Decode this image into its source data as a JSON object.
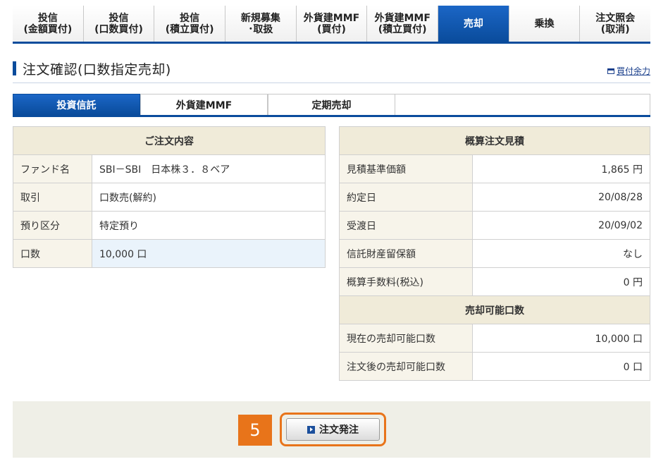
{
  "nav": {
    "tabs": [
      {
        "label": "投信\n(金額買付)"
      },
      {
        "label": "投信\n(口数買付)"
      },
      {
        "label": "投信\n(積立買付)"
      },
      {
        "label": "新規募集\n･取扱"
      },
      {
        "label": "外貨建MMF\n(買付)"
      },
      {
        "label": "外貨建MMF\n(積立買付)"
      },
      {
        "label": "売却"
      },
      {
        "label": "乗換"
      },
      {
        "label": "注文照会\n(取消)"
      }
    ]
  },
  "page": {
    "title": "注文確認(口数指定売却)",
    "buy_power_link": "買付余力"
  },
  "subtabs": [
    "投資信託",
    "外貨建MMF",
    "定期売却"
  ],
  "order_content": {
    "header": "ご注文内容",
    "rows": [
      {
        "label": "ファンド名",
        "value": "SBI－SBI　日本株３．８ベア"
      },
      {
        "label": "取引",
        "value": "口数売(解約)"
      },
      {
        "label": "預り区分",
        "value": "特定預り"
      },
      {
        "label": "口数",
        "value": "10,000 口"
      }
    ]
  },
  "estimate": {
    "header": "概算注文見積",
    "rows": [
      {
        "label": "見積基準価額",
        "value": "1,865 円"
      },
      {
        "label": "約定日",
        "value": "20/08/28"
      },
      {
        "label": "受渡日",
        "value": "20/09/02"
      },
      {
        "label": "信託財産留保額",
        "value": "なし"
      },
      {
        "label": "概算手数料(税込)",
        "value": "0 円"
      }
    ]
  },
  "sellable": {
    "header": "売却可能口数",
    "rows": [
      {
        "label": "現在の売却可能口数",
        "value": "10,000 口"
      },
      {
        "label": "注文後の売却可能口数",
        "value": "0 口"
      }
    ]
  },
  "action": {
    "step": "5",
    "order_button": "注文発注"
  },
  "colors": {
    "accent_blue": "#0a4c9c",
    "highlight_orange": "#e8741a"
  }
}
